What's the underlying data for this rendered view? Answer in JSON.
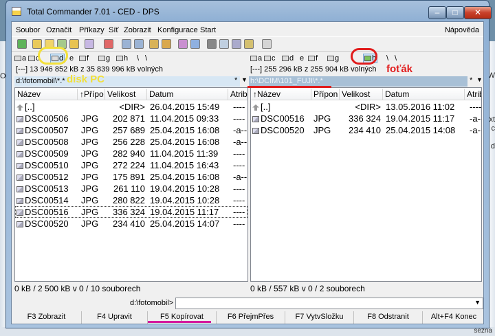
{
  "window": {
    "title": "Total Commander 7.01 - CED - DPS",
    "min": "–",
    "max": "□",
    "close": "✕"
  },
  "desktop": {
    "left_text": "OS",
    "right_texts": [
      "W",
      "xt",
      "c",
      "d"
    ],
    "bottom_text": "sezna"
  },
  "menu": [
    "Soubor",
    "Označit",
    "Příkazy",
    "Síť",
    "Zobrazit",
    "Konfigurace",
    "Start"
  ],
  "menu_help": "Nápověda",
  "left": {
    "drives": [
      "a",
      "c",
      "d",
      "e",
      "f",
      "g",
      "h",
      "\\",
      "\\"
    ],
    "selected_drive": "d",
    "free": "[---]  13 946 852 kB z 35 839 996 kB volných",
    "path": "d:\\fotomobil\\*.*",
    "headers": [
      "Název",
      "↑Přípo",
      "Velikost",
      "Datum",
      "Atrib"
    ],
    "rows": [
      {
        "name": "[..]",
        "ext": "",
        "size": "<DIR>",
        "date": "26.04.2015 15:49",
        "attr": "----",
        "up": true
      },
      {
        "name": "DSC00506",
        "ext": "JPG",
        "size": "202 871",
        "date": "11.04.2015 09:33",
        "attr": "----"
      },
      {
        "name": "DSC00507",
        "ext": "JPG",
        "size": "257 689",
        "date": "25.04.2015 16:08",
        "attr": "-a--"
      },
      {
        "name": "DSC00508",
        "ext": "JPG",
        "size": "256 228",
        "date": "25.04.2015 16:08",
        "attr": "-a--"
      },
      {
        "name": "DSC00509",
        "ext": "JPG",
        "size": "282 940",
        "date": "11.04.2015 11:39",
        "attr": "----"
      },
      {
        "name": "DSC00510",
        "ext": "JPG",
        "size": "272 224",
        "date": "11.04.2015 16:43",
        "attr": "----"
      },
      {
        "name": "DSC00512",
        "ext": "JPG",
        "size": "175 891",
        "date": "25.04.2015 16:08",
        "attr": "-a--"
      },
      {
        "name": "DSC00513",
        "ext": "JPG",
        "size": "261 110",
        "date": "19.04.2015 10:28",
        "attr": "----"
      },
      {
        "name": "DSC00514",
        "ext": "JPG",
        "size": "280 822",
        "date": "19.04.2015 10:28",
        "attr": "----"
      },
      {
        "name": "DSC00516",
        "ext": "JPG",
        "size": "336 324",
        "date": "19.04.2015 11:17",
        "attr": "----",
        "cursor": true
      },
      {
        "name": "DSC00520",
        "ext": "JPG",
        "size": "234 410",
        "date": "25.04.2015 14:07",
        "attr": "----"
      }
    ],
    "status": "0 kB / 2 500 kB v 0 / 10 souborech"
  },
  "right": {
    "drives": [
      "a",
      "c",
      "d",
      "e",
      "f",
      "g",
      "h",
      "\\",
      "\\"
    ],
    "selected_drive": "h",
    "free": "[---]  255 296 kB z 255 904 kB volných",
    "path": "h:\\DCIM\\101_FUJI\\*.*",
    "headers": [
      "↑Název",
      "Přípon",
      "Velikost",
      "Datum",
      "Atrib"
    ],
    "rows": [
      {
        "name": "[..]",
        "ext": "",
        "size": "<DIR>",
        "date": "13.05.2016 11:02",
        "attr": "----",
        "up": true
      },
      {
        "name": "DSC00516",
        "ext": "JPG",
        "size": "336 324",
        "date": "19.04.2015 11:17",
        "attr": "-a--"
      },
      {
        "name": "DSC00520",
        "ext": "JPG",
        "size": "234 410",
        "date": "25.04.2015 14:08",
        "attr": "-a--"
      }
    ],
    "status": "0 kB / 557 kB v 0 / 2 souborech"
  },
  "path_ctrl": {
    "star": "*",
    "arrow": "▼"
  },
  "cmdline": {
    "label": "d:\\fotomobil>",
    "value": "",
    "arrow": "▼"
  },
  "fkeys": [
    "F3 Zobrazit",
    "F4 Upravit",
    "F5 Kopírovat",
    "F6 PřejmPřes",
    "F7 VytvSložku",
    "F8 Odstranit",
    "Alt+F4 Konec"
  ],
  "annotations": {
    "disk_label": "disk PC",
    "camera_label": "foťák"
  },
  "colors": {
    "yellow": "#f3e03a",
    "red": "#e11c1c",
    "pink": "#d51b9e"
  }
}
